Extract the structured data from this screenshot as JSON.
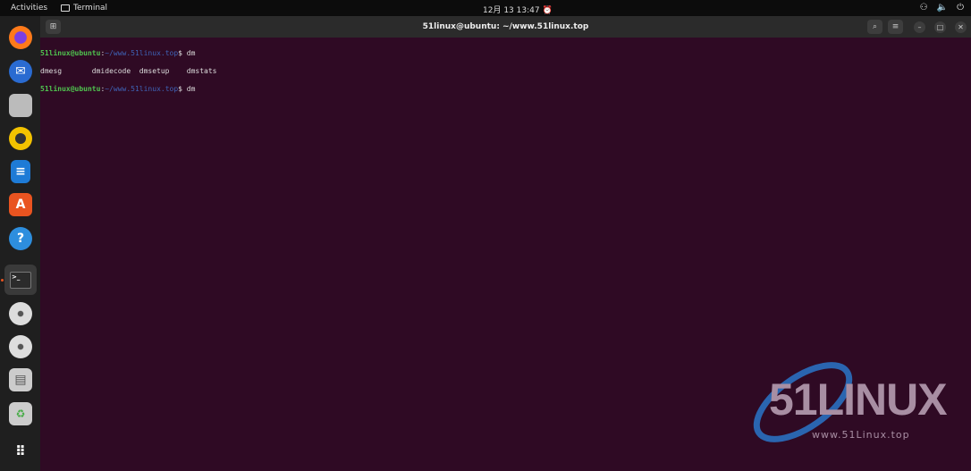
{
  "topbar": {
    "activities": "Activities",
    "app": "Terminal",
    "clock": "12月 13  13:47",
    "icons": [
      "network-icon",
      "volume-icon",
      "power-icon"
    ]
  },
  "dock": {
    "items": [
      "firefox",
      "thunderbird",
      "files",
      "rhythmbox",
      "libreoffice-writer",
      "software",
      "help",
      "terminal",
      "cd-drive-1",
      "cd-drive-2",
      "save-disk",
      "trash",
      "show-apps"
    ]
  },
  "terminal": {
    "title": "51linux@ubuntu: ~/www.51linux.top",
    "lines": [
      {
        "user": "51linux@ubuntu",
        "sep": ":",
        "path": "~/www.51linux.top",
        "prompt": "$ ",
        "cmd": "dm"
      },
      {
        "output": "dmesg       dmidecode  dmsetup    dmstats"
      },
      {
        "user": "51linux@ubuntu",
        "sep": ":",
        "path": "~/www.51linux.top",
        "prompt": "$ ",
        "cmd": "dm"
      }
    ]
  },
  "watermark": {
    "brand": "51LINUX",
    "url": "www.51Linux.top"
  }
}
